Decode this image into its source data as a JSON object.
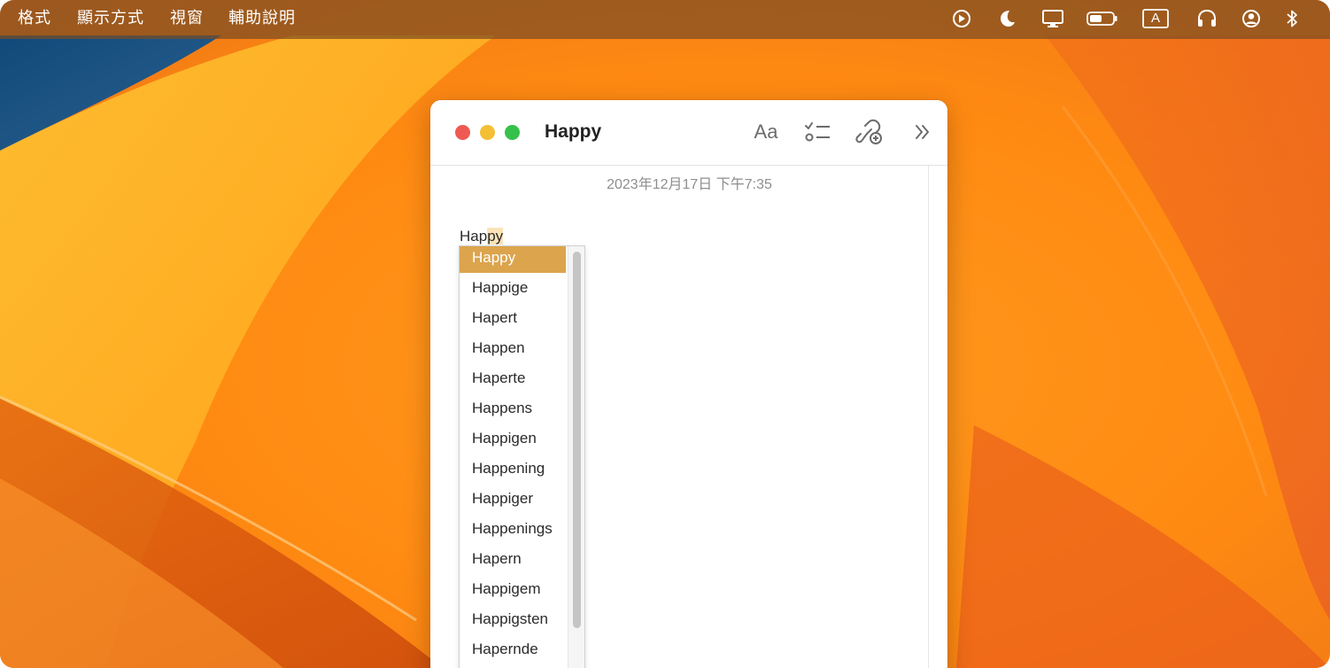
{
  "menubar": {
    "items": [
      {
        "label": "格式"
      },
      {
        "label": "顯示方式"
      },
      {
        "label": "視窗"
      },
      {
        "label": "輔助說明"
      }
    ],
    "status_icons": [
      "play-circle-icon",
      "moon-icon",
      "display-icon",
      "battery-icon",
      "input-source-icon",
      "headphones-icon",
      "user-account-icon",
      "bluetooth-icon"
    ],
    "input_source_label": "A",
    "battery_level": 0.55
  },
  "window": {
    "title": "Happy",
    "toolbar": {
      "format_label": "Aa",
      "icons": [
        "checklist-icon",
        "collaborate-icon",
        "more-icon"
      ]
    }
  },
  "note": {
    "date": "2023年12月17日 下午7:35",
    "text_before": "Hap",
    "text_highlight": "py"
  },
  "suggestions": {
    "selected_index": 0,
    "items": [
      "Happy",
      "Happige",
      "Hapert",
      "Happen",
      "Haperte",
      "Happens",
      "Happigen",
      "Happening",
      "Happiger",
      "Happenings",
      "Hapern",
      "Happigem",
      "Happigsten",
      "Hapernde"
    ]
  },
  "colors": {
    "menubar_bg": "#7c4c22",
    "highlight_selected": "#dca44c",
    "text_highlight": "#fbe3b8",
    "close": "#ee5a52",
    "minimize": "#f4bf35",
    "zoom": "#35c14b"
  }
}
